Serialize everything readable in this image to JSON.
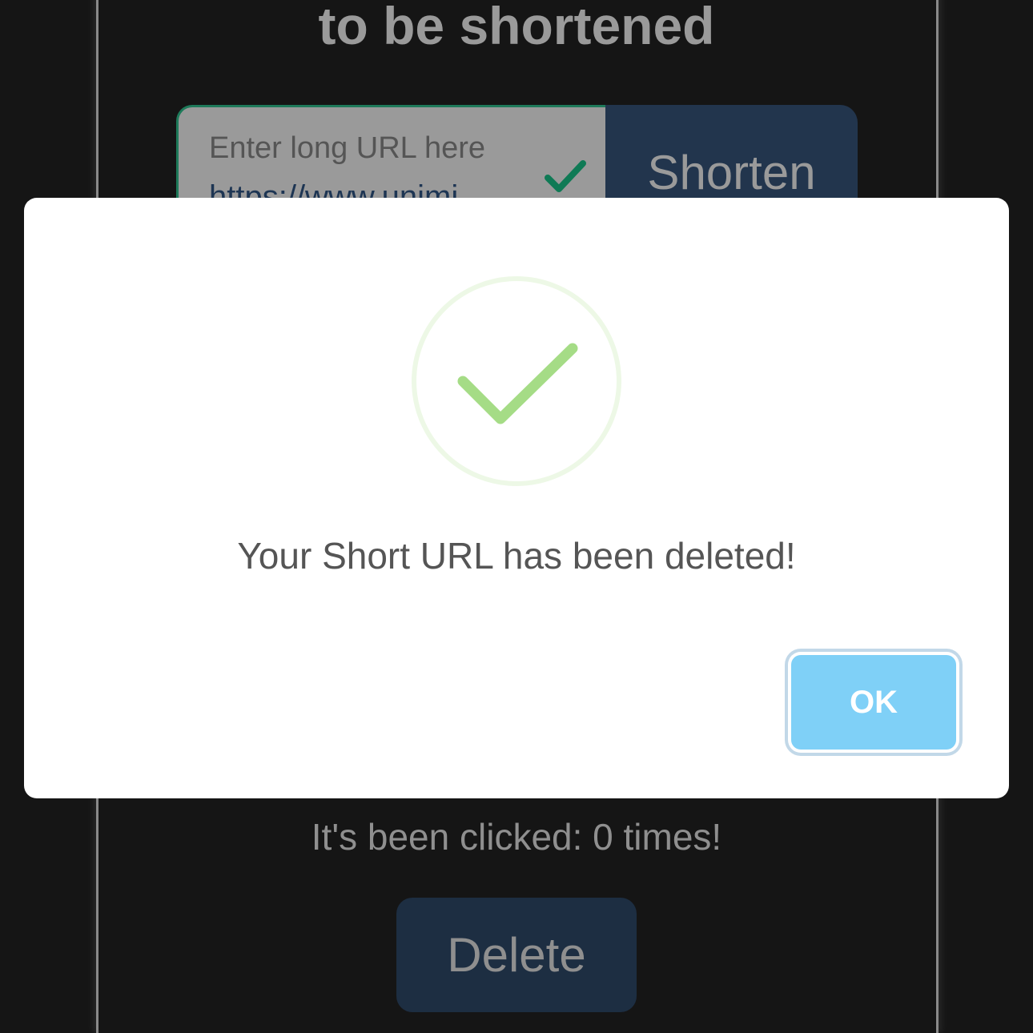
{
  "page": {
    "heading": "to be shortened",
    "url_input": {
      "placeholder": "Enter long URL here",
      "value": "https://www.unimi"
    },
    "shorten_label": "Shorten",
    "clicked_text": "It's been clicked: 0 times!",
    "delete_label": "Delete"
  },
  "modal": {
    "icon": "success-check-icon",
    "message": "Your Short URL has been deleted!",
    "ok_label": "OK"
  },
  "colors": {
    "background": "#151515",
    "button_dark": "#22354d",
    "success_green": "#a5dc86",
    "ok_button": "#7fd0f7",
    "input_valid": "#1e7a5a"
  }
}
